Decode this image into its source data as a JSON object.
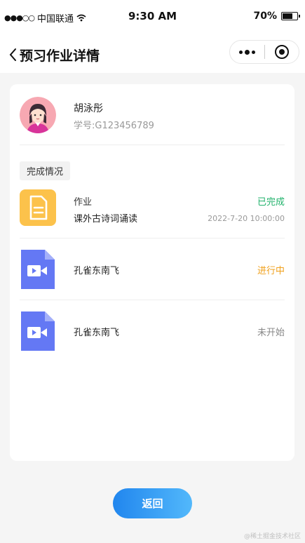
{
  "status_bar": {
    "carrier": "中国联通",
    "time": "9:30 AM",
    "battery": "70%",
    "battery_level": 0.7
  },
  "nav": {
    "title": "预习作业详情"
  },
  "student": {
    "name": "胡泳彤",
    "id_label": "学号:G123456789"
  },
  "section": {
    "label": "完成情况"
  },
  "tasks": [
    {
      "icon": "document-icon",
      "type": "作业",
      "title": "课外古诗词诵读",
      "status": "已完成",
      "status_color": "#20b26b",
      "time": "2022-7-20 10:00:00"
    },
    {
      "icon": "video-file-icon",
      "title": "孔雀东南飞",
      "status": "进行中",
      "status_color": "#f0a01b"
    },
    {
      "icon": "video-file-icon",
      "title": "孔雀东南飞",
      "status": "未开始",
      "status_color": "#888888"
    }
  ],
  "footer": {
    "return_label": "返回"
  },
  "watermark": "@稀土掘金技术社区"
}
